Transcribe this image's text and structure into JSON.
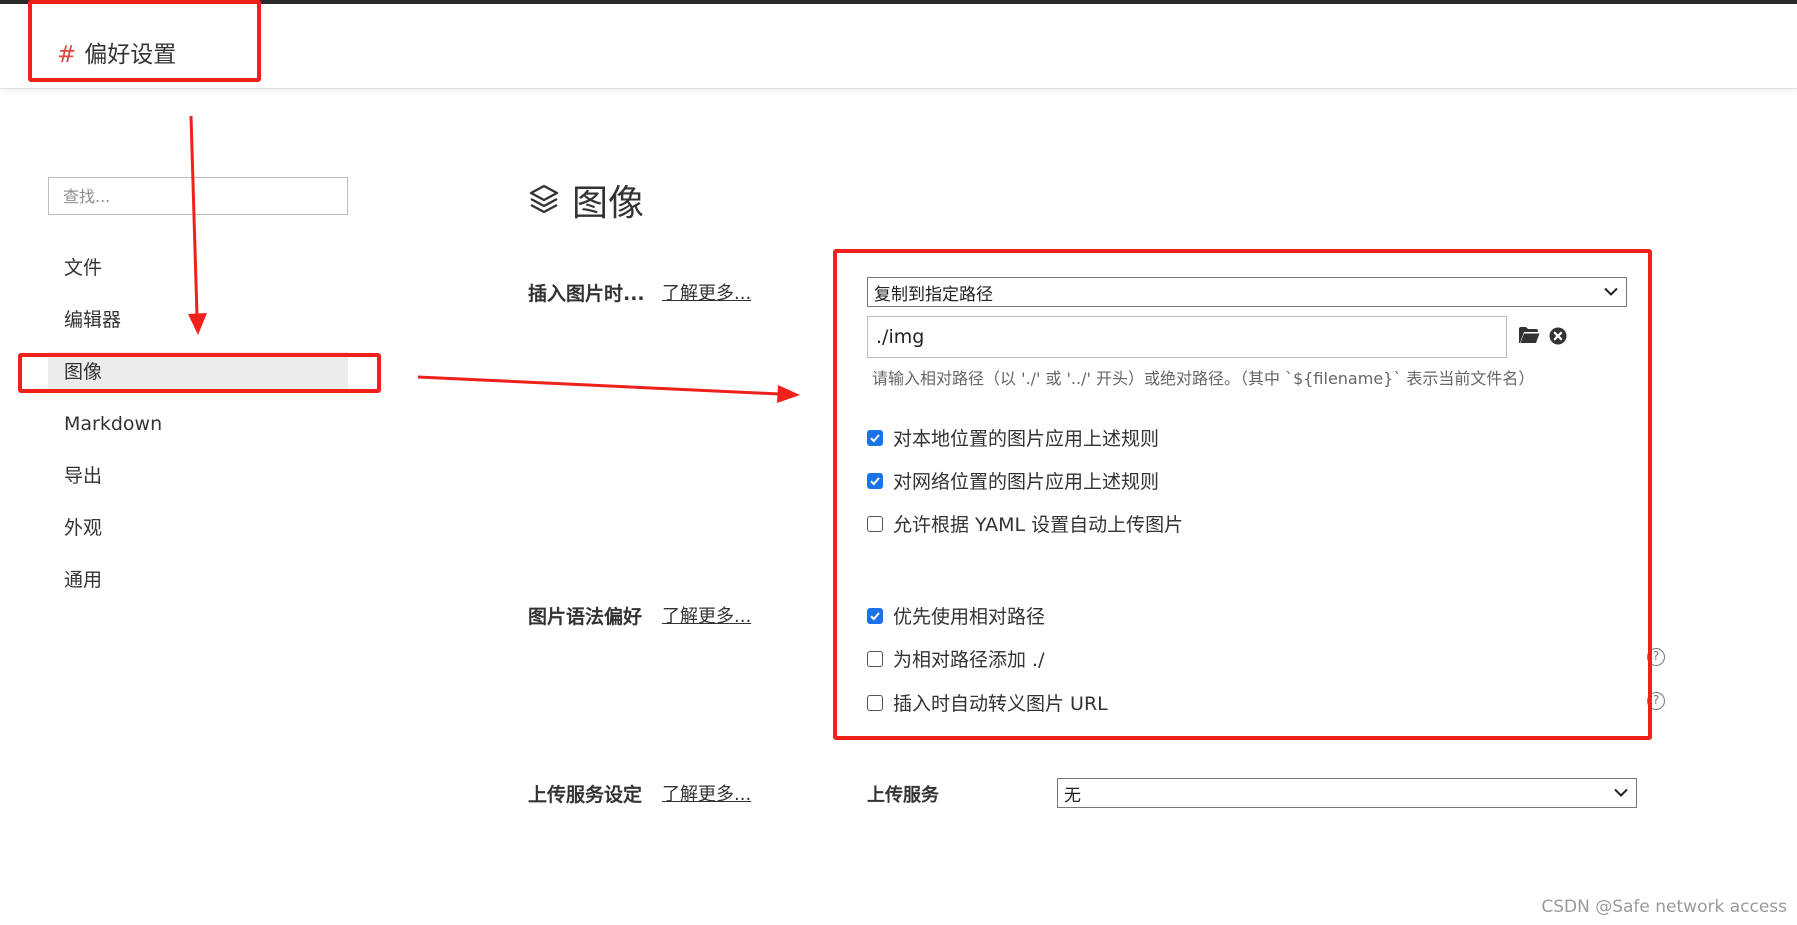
{
  "header": {
    "hash": "#",
    "title": "偏好设置"
  },
  "sidebar": {
    "search_placeholder": "查找...",
    "items": [
      {
        "label": "文件"
      },
      {
        "label": "编辑器"
      },
      {
        "label": "图像",
        "active": true
      },
      {
        "label": "Markdown"
      },
      {
        "label": "导出"
      },
      {
        "label": "外观"
      },
      {
        "label": "通用"
      }
    ]
  },
  "main": {
    "section_icon": "layers-icon",
    "section_title": "图像",
    "learn_more": "了解更多...",
    "insert": {
      "label": "插入图片时...",
      "select_value": "复制到指定路径",
      "path_value": "./img",
      "folder_icon": "folder-icon",
      "clear_icon": "close-circle-icon",
      "hint": "请输入相对路径（以 './' 或 '../' 开头）或绝对路径。（其中 `${filename}` 表示当前文件名）",
      "options": [
        {
          "label": "对本地位置的图片应用上述规则",
          "checked": true
        },
        {
          "label": "对网络位置的图片应用上述规则",
          "checked": true
        },
        {
          "label": "允许根据 YAML 设置自动上传图片",
          "checked": false
        }
      ]
    },
    "syntax": {
      "label": "图片语法偏好",
      "options": [
        {
          "label": "优先使用相对路径",
          "checked": true
        },
        {
          "label": "为相对路径添加 ./",
          "checked": false
        },
        {
          "label": "插入时自动转义图片 URL",
          "checked": false
        }
      ]
    },
    "upload": {
      "label": "上传服务设定",
      "service_label": "上传服务",
      "service_value": "无"
    }
  },
  "colors": {
    "accent": "#1a73e8",
    "annotation": "#f0201a",
    "hash": "#d94a3f"
  },
  "watermark": "CSDN @Safe network access"
}
